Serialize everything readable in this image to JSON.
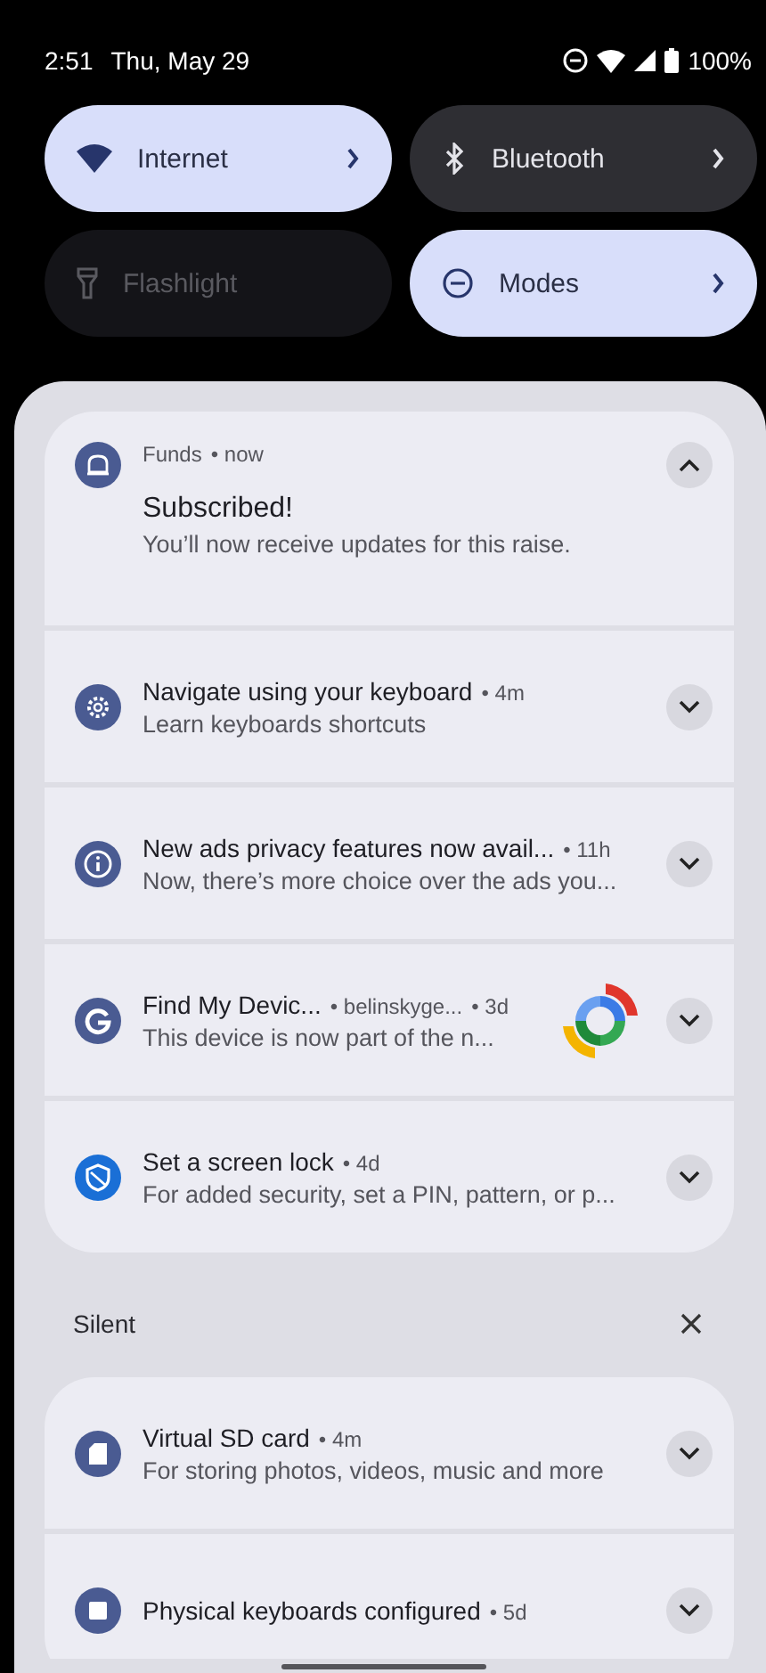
{
  "status_bar": {
    "time": "2:51",
    "date": "Thu, May 29",
    "battery": "100%"
  },
  "tiles": [
    {
      "label": "Internet",
      "kind": "wifi",
      "on": true,
      "disabled": false,
      "has_details": true
    },
    {
      "label": "Bluetooth",
      "kind": "bluetooth",
      "on": false,
      "disabled": false,
      "has_details": true
    },
    {
      "label": "Flashlight",
      "kind": "flashlight",
      "on": false,
      "disabled": true,
      "has_details": false
    },
    {
      "label": "Modes",
      "kind": "modes",
      "on": true,
      "disabled": false,
      "has_details": true
    }
  ],
  "groups": [
    {
      "notifications": [
        {
          "kind": "bell",
          "color": "#4a5b92",
          "app": "Funds",
          "time": "• now",
          "title": "Subscribed!",
          "body": "You’ll now receive updates for this raise.",
          "expanded": true
        },
        {
          "kind": "gear",
          "color": "#4a5b92",
          "title": "Navigate using your keyboard",
          "time": "• 4m",
          "body": "Learn keyboards shortcuts",
          "expanded": false
        },
        {
          "kind": "info",
          "color": "#4a5b92",
          "title": "New ads privacy features now avail...",
          "time": "• 11h",
          "body": "Now, there’s more choice over the ads you...",
          "expanded": false
        },
        {
          "kind": "g",
          "color": "#4a5b92",
          "title": "Find My Devic...",
          "account": "• belinskyge...",
          "time": "• 3d",
          "body": "This device is now part of the n...",
          "large_icon": true,
          "expanded": false
        },
        {
          "kind": "shield",
          "color": "#1a6fd6",
          "title": "Set a screen lock",
          "time": "• 4d",
          "body": "For added security, set a PIN, pattern, or p...",
          "expanded": false
        }
      ]
    },
    {
      "header": "Silent",
      "notifications": [
        {
          "kind": "sdcard",
          "color": "#4a5b92",
          "title": "Virtual SD card",
          "time": "• 4m",
          "body": "For storing photos, videos, music and more",
          "expanded": false
        },
        {
          "kind": "keyboard",
          "color": "#4a5b92",
          "title": "Physical keyboards configured",
          "time": "• 5d",
          "expanded": false
        }
      ]
    }
  ]
}
